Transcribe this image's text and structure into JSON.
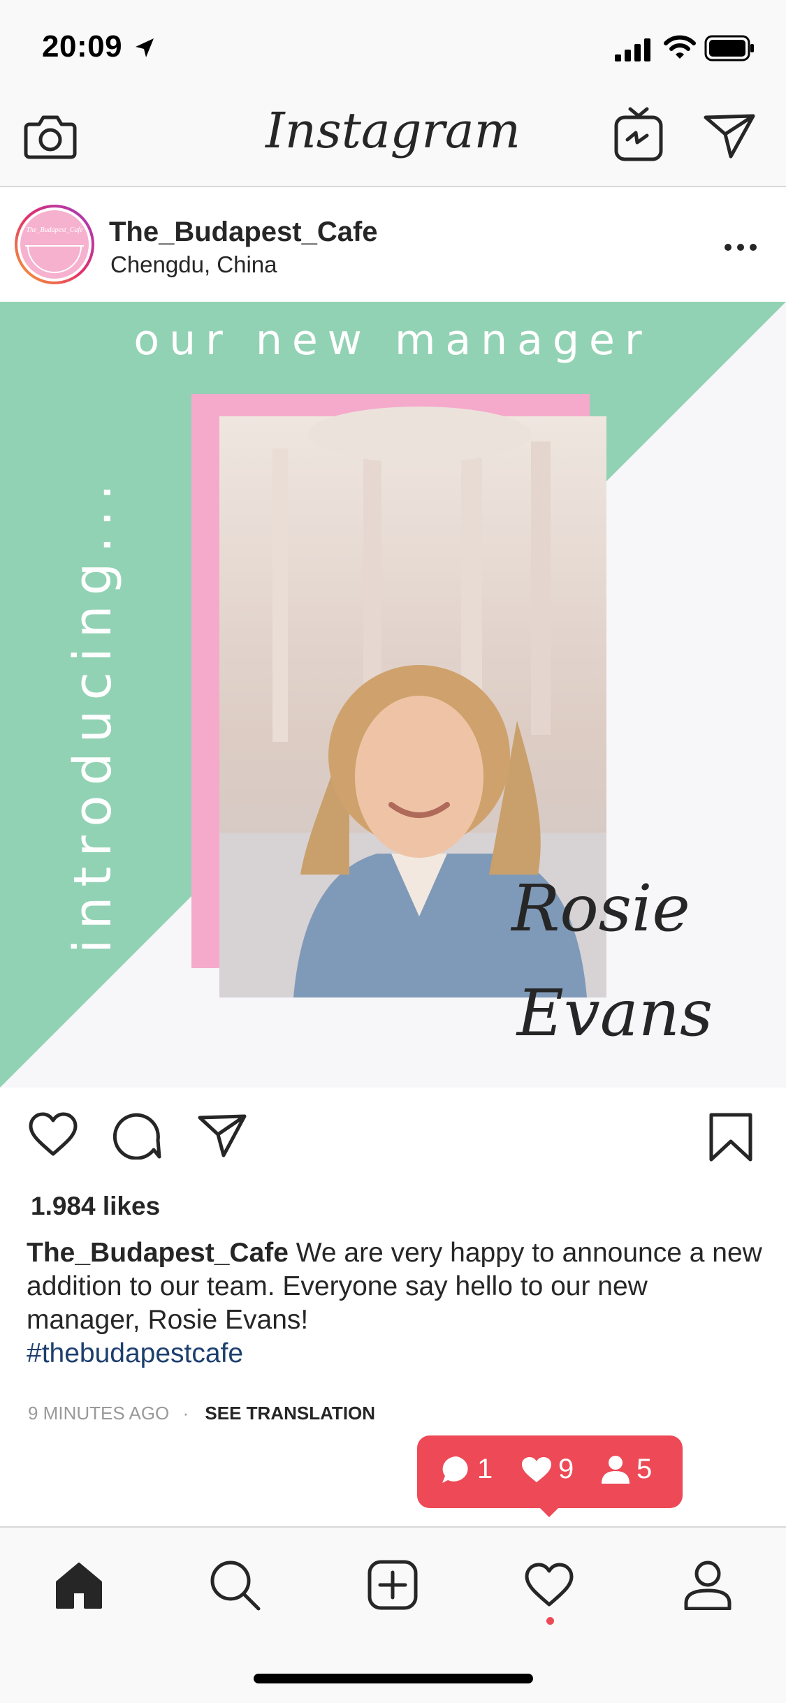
{
  "status_bar": {
    "time": "20:09"
  },
  "header": {
    "logo_text": "Instagram"
  },
  "post": {
    "username": "The_Budapest_Cafe",
    "location": "Chengdu, China",
    "avatar_text": "The_Budapest_Cafe",
    "image": {
      "headline": "our new manager",
      "vertical_text": "introducing...",
      "name_line1": "Rosie",
      "name_line2": "Evans",
      "colors": {
        "mint": "#92d2b4",
        "pink": "#f5aacb",
        "background": "#f7f7fa"
      }
    },
    "likes": "1.984 likes",
    "caption_username": "The_Budapest_Cafe",
    "caption_text": "We are very happy to announce a new addition to our team. Everyone say hello to our new manager, Rosie Evans!",
    "hashtag": "#thebudapestcafe",
    "timestamp": "9 MINUTES AGO",
    "see_translation": "SEE TRANSLATION"
  },
  "activity": {
    "comments": "1",
    "likes": "9",
    "follows": "5",
    "color": "#ed4956"
  },
  "tabs": [
    "home-icon",
    "search-icon",
    "add-icon",
    "heart-icon",
    "profile-icon"
  ]
}
